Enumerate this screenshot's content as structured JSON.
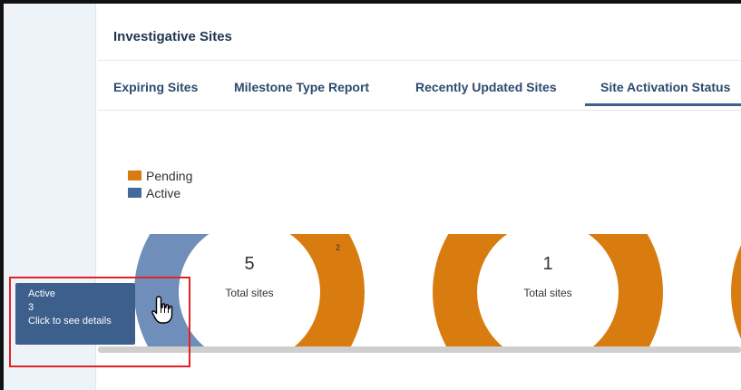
{
  "panel": {
    "title": "Investigative Sites"
  },
  "tabs": [
    {
      "label": "Expiring Sites",
      "active": false
    },
    {
      "label": "Milestone Type Report",
      "active": false
    },
    {
      "label": "Recently Updated Sites",
      "active": false
    },
    {
      "label": "Site Activation Status",
      "active": true
    }
  ],
  "legend": [
    {
      "label": "Pending",
      "color": "#d97c0f"
    },
    {
      "label": "Active",
      "color": "#436a9a"
    }
  ],
  "charts": [
    {
      "total": "5",
      "total_label": "Total sites",
      "active": 3,
      "pending": 2,
      "pending_label": "2"
    },
    {
      "total": "1",
      "total_label": "Total sites",
      "active": 0,
      "pending": 1
    }
  ],
  "tooltip": {
    "line1": "Active",
    "line2": "3",
    "line3": "Click to see details"
  },
  "colors": {
    "pending": "#d97c0f",
    "active": "#436a9a",
    "active_hover": "#6f8fba",
    "accent": "#3c5f8c",
    "highlight": "#e32227"
  },
  "icons": {
    "cursor": "hand-pointer-icon"
  }
}
